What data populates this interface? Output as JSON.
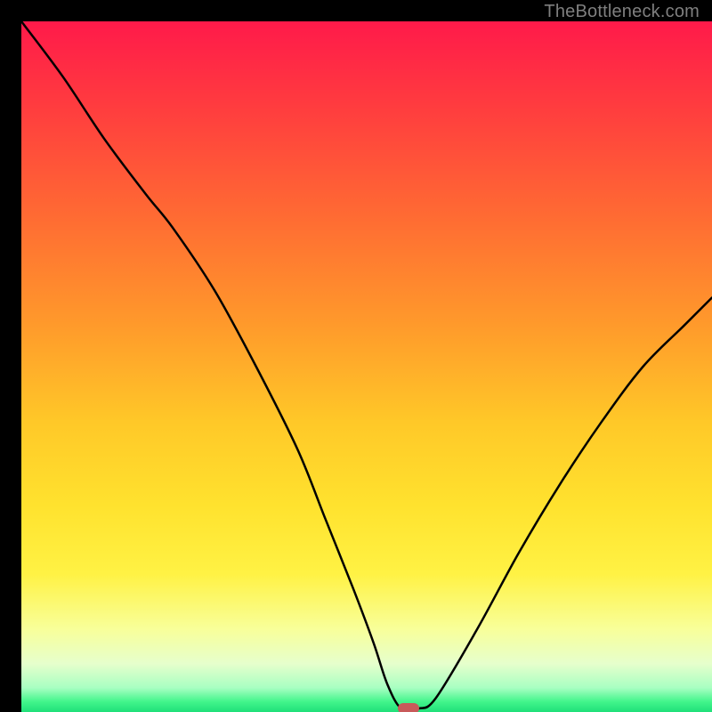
{
  "watermark": "TheBottleneck.com",
  "marker_color": "#c85a5a",
  "gradient_stops": [
    {
      "offset": 0.0,
      "color": "#ff1a4a"
    },
    {
      "offset": 0.12,
      "color": "#ff3b3f"
    },
    {
      "offset": 0.28,
      "color": "#ff6a33"
    },
    {
      "offset": 0.44,
      "color": "#ff9a2b"
    },
    {
      "offset": 0.58,
      "color": "#ffc828"
    },
    {
      "offset": 0.7,
      "color": "#ffe22e"
    },
    {
      "offset": 0.8,
      "color": "#fff244"
    },
    {
      "offset": 0.88,
      "color": "#f8ff9a"
    },
    {
      "offset": 0.93,
      "color": "#e6ffcc"
    },
    {
      "offset": 0.965,
      "color": "#a8ffc2"
    },
    {
      "offset": 0.985,
      "color": "#42f58b"
    },
    {
      "offset": 1.0,
      "color": "#1fe07a"
    }
  ],
  "chart_data": {
    "type": "line",
    "title": "",
    "xlabel": "",
    "ylabel": "",
    "xlim": [
      0,
      100
    ],
    "ylim": [
      0,
      100
    ],
    "x": [
      0,
      6,
      12,
      18,
      22,
      28,
      34,
      40,
      44,
      48,
      51,
      53,
      55,
      57.5,
      60,
      66,
      72,
      78,
      84,
      90,
      96,
      100
    ],
    "values": [
      100,
      92,
      83,
      75,
      70,
      61,
      50,
      38,
      28,
      18,
      10,
      4,
      0.5,
      0.5,
      2,
      12,
      23,
      33,
      42,
      50,
      56,
      60
    ],
    "marker": {
      "x": 56,
      "y": 0.5
    },
    "grid": false
  }
}
